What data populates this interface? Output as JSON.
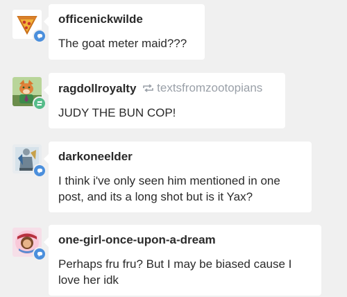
{
  "notes": [
    {
      "username": "officenickwilde",
      "text": "The goat meter maid???",
      "badge": "reply-icon",
      "avatar": "pizza-slice-avatar"
    },
    {
      "username": "ragdollroyalty",
      "reblogged_from": "textsfromzootopians",
      "text": "JUDY THE BUN COP!",
      "badge": "reblog-icon",
      "avatar": "fox-character-avatar"
    },
    {
      "username": "darkoneelder",
      "text": "I think i've only seen him mentioned in one post, and its a long shot but is it Yax?",
      "badge": "reply-icon",
      "avatar": "sketch-figure-avatar"
    },
    {
      "username": "one-girl-once-upon-a-dream",
      "text": "Perhaps fru fru? But I may be biased cause I love her idk",
      "badge": "reply-icon",
      "avatar": "princess-badge-avatar"
    }
  ],
  "colors": {
    "background": "#f0f0f0",
    "bubble": "#ffffff",
    "reply_badge": "#4b8fdc",
    "reblog_badge": "#56bc8a",
    "muted_text": "#9aa0a8"
  }
}
